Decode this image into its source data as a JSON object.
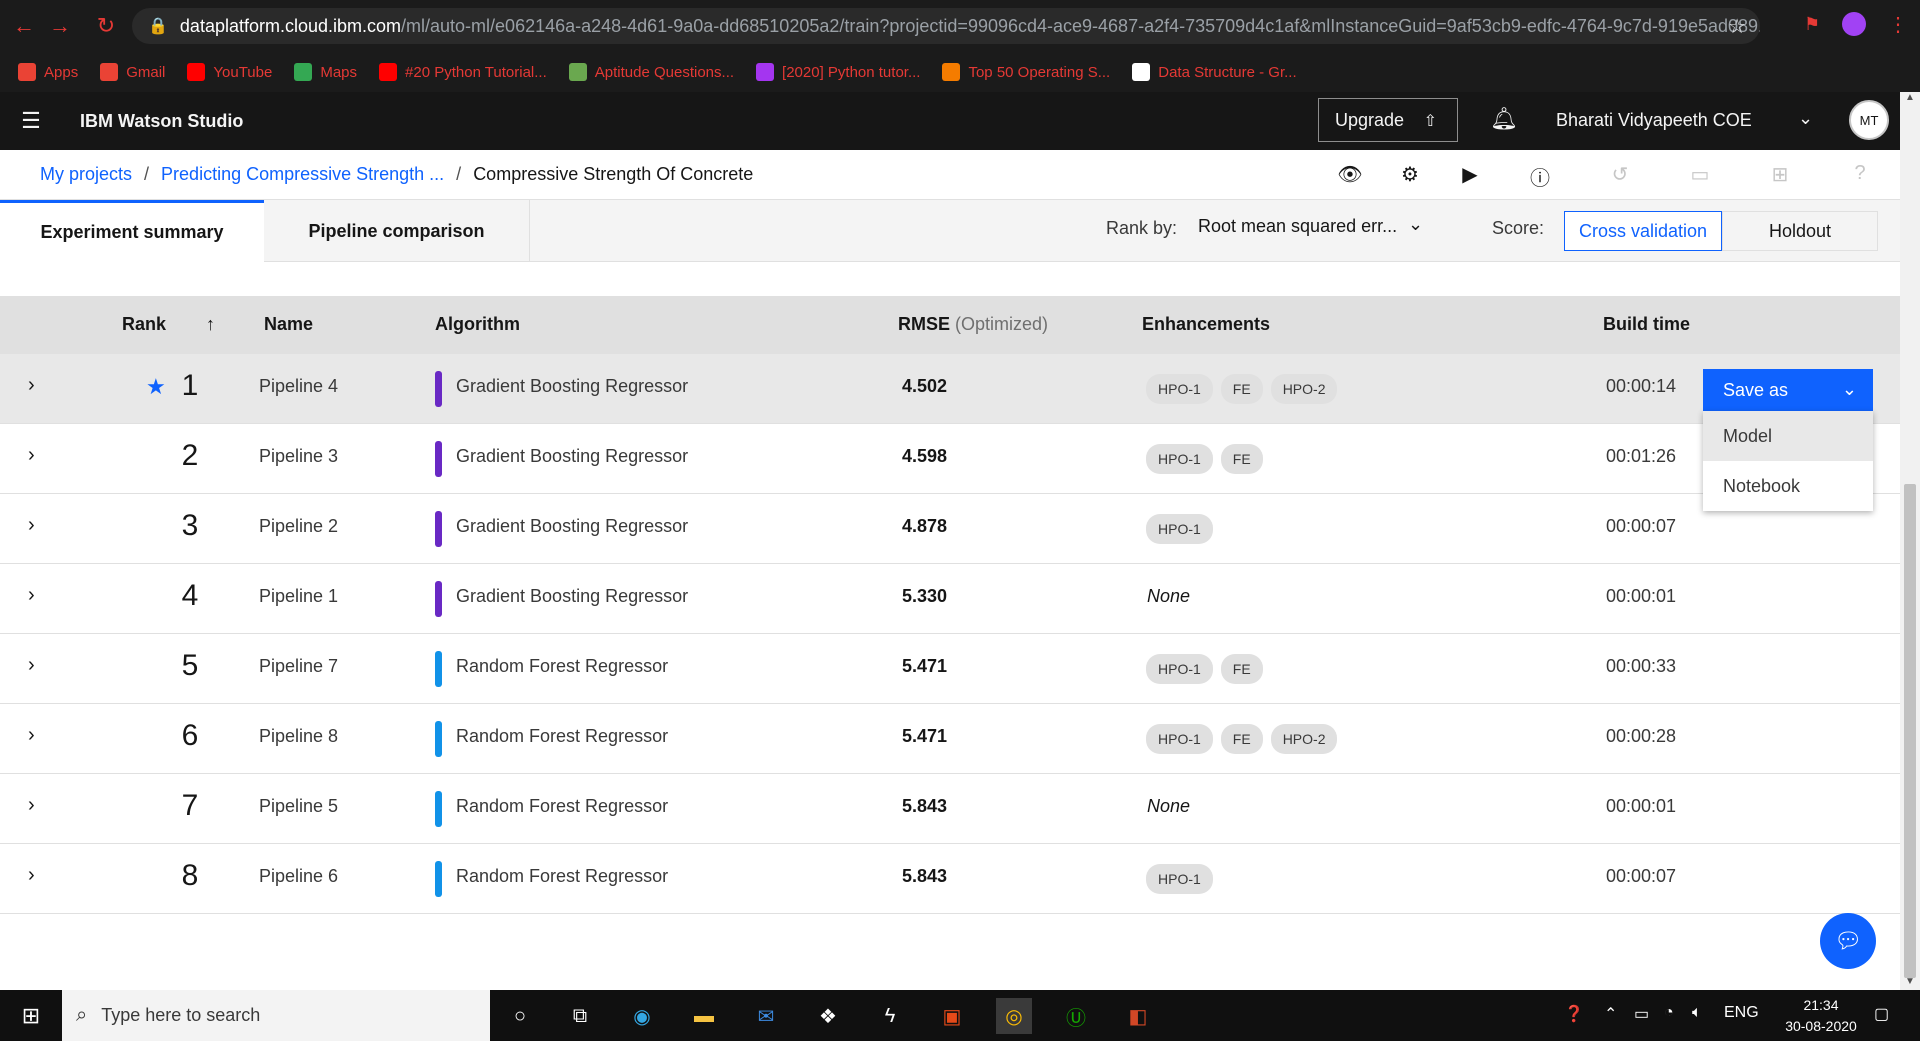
{
  "browser": {
    "url_host": "dataplatform.cloud.ibm.com",
    "url_path": "/ml/auto-ml/e062146a-a248-4d61-9a0a-dd68510205a2/train?projectid=99096cd4-ace9-4687-a2f4-735709d4c1af&mlInstanceGuid=9af53cb9-edfc-4764-9c7d-919e5ad089...",
    "bookmarks": [
      {
        "label": "Apps",
        "icon": "apps-grid-icon",
        "color": "#ea4335"
      },
      {
        "label": "Gmail",
        "icon": "gmail-icon",
        "color": "#ea4335"
      },
      {
        "label": "YouTube",
        "icon": "youtube-icon",
        "color": "#ff0000"
      },
      {
        "label": "Maps",
        "icon": "maps-pin-icon",
        "color": "#34a853"
      },
      {
        "label": "#20 Python Tutorial...",
        "icon": "youtube-icon",
        "color": "#ff0000"
      },
      {
        "label": "Aptitude Questions...",
        "icon": "leaf-icon",
        "color": "#6aa84f"
      },
      {
        "label": "[2020] Python tutor...",
        "icon": "udemy-icon",
        "color": "#a435f0"
      },
      {
        "label": "Top 50 Operating S...",
        "icon": "orange-circle-icon",
        "color": "#f57c00"
      },
      {
        "label": "Data Structure - Gr...",
        "icon": "geeks-icon",
        "color": "#ffffff"
      }
    ]
  },
  "appbar": {
    "product": "IBM Watson Studio",
    "upgrade_label": "Upgrade",
    "account_name": "Bharati Vidyapeeth COE",
    "avatar_initials": "MT"
  },
  "breadcrumb": {
    "items": [
      "My projects",
      "Predicting Compressive Strength ...",
      "Compressive Strength Of Concrete"
    ],
    "sep": "/"
  },
  "tabs": [
    "Experiment summary",
    "Pipeline comparison"
  ],
  "rank_by": {
    "label": "Rank by:",
    "value": "Root mean squared err..."
  },
  "score": {
    "label": "Score:",
    "options": [
      "Cross validation",
      "Holdout"
    ],
    "selected": "Cross validation"
  },
  "table": {
    "headers": {
      "rank": "Rank",
      "name": "Name",
      "algorithm": "Algorithm",
      "rmse": "RMSE",
      "rmse_sub": "(Optimized)",
      "enhancements": "Enhancements",
      "build_time": "Build time"
    },
    "rows": [
      {
        "rank": "1",
        "name": "Pipeline 4",
        "algorithm": "Gradient Boosting Regressor",
        "alg_color": "#6929c4",
        "rmse": "4.502",
        "enh": [
          "HPO-1",
          "FE",
          "HPO-2"
        ],
        "time": "00:00:14",
        "starred": true
      },
      {
        "rank": "2",
        "name": "Pipeline 3",
        "algorithm": "Gradient Boosting Regressor",
        "alg_color": "#6929c4",
        "rmse": "4.598",
        "enh": [
          "HPO-1",
          "FE"
        ],
        "time": "00:01:26"
      },
      {
        "rank": "3",
        "name": "Pipeline 2",
        "algorithm": "Gradient Boosting Regressor",
        "alg_color": "#6929c4",
        "rmse": "4.878",
        "enh": [
          "HPO-1"
        ],
        "time": "00:00:07"
      },
      {
        "rank": "4",
        "name": "Pipeline 1",
        "algorithm": "Gradient Boosting Regressor",
        "alg_color": "#6929c4",
        "rmse": "5.330",
        "enh": [],
        "none_label": "None",
        "time": "00:00:01"
      },
      {
        "rank": "5",
        "name": "Pipeline 7",
        "algorithm": "Random Forest Regressor",
        "alg_color": "#1192e8",
        "rmse": "5.471",
        "enh": [
          "HPO-1",
          "FE"
        ],
        "time": "00:00:33"
      },
      {
        "rank": "6",
        "name": "Pipeline 8",
        "algorithm": "Random Forest Regressor",
        "alg_color": "#1192e8",
        "rmse": "5.471",
        "enh": [
          "HPO-1",
          "FE",
          "HPO-2"
        ],
        "time": "00:00:28"
      },
      {
        "rank": "7",
        "name": "Pipeline 5",
        "algorithm": "Random Forest Regressor",
        "alg_color": "#1192e8",
        "rmse": "5.843",
        "enh": [],
        "none_label": "None",
        "time": "00:00:01"
      },
      {
        "rank": "8",
        "name": "Pipeline 6",
        "algorithm": "Random Forest Regressor",
        "alg_color": "#1192e8",
        "rmse": "5.843",
        "enh": [
          "HPO-1"
        ],
        "time": "00:00:07"
      }
    ]
  },
  "save_as": {
    "label": "Save as",
    "menu": [
      "Model",
      "Notebook"
    ]
  },
  "taskbar": {
    "search_placeholder": "Type here to search",
    "language": "ENG",
    "time": "21:34",
    "date": "30-08-2020"
  },
  "colors": {
    "accent": "#0f62fe",
    "appbar": "#161616"
  }
}
